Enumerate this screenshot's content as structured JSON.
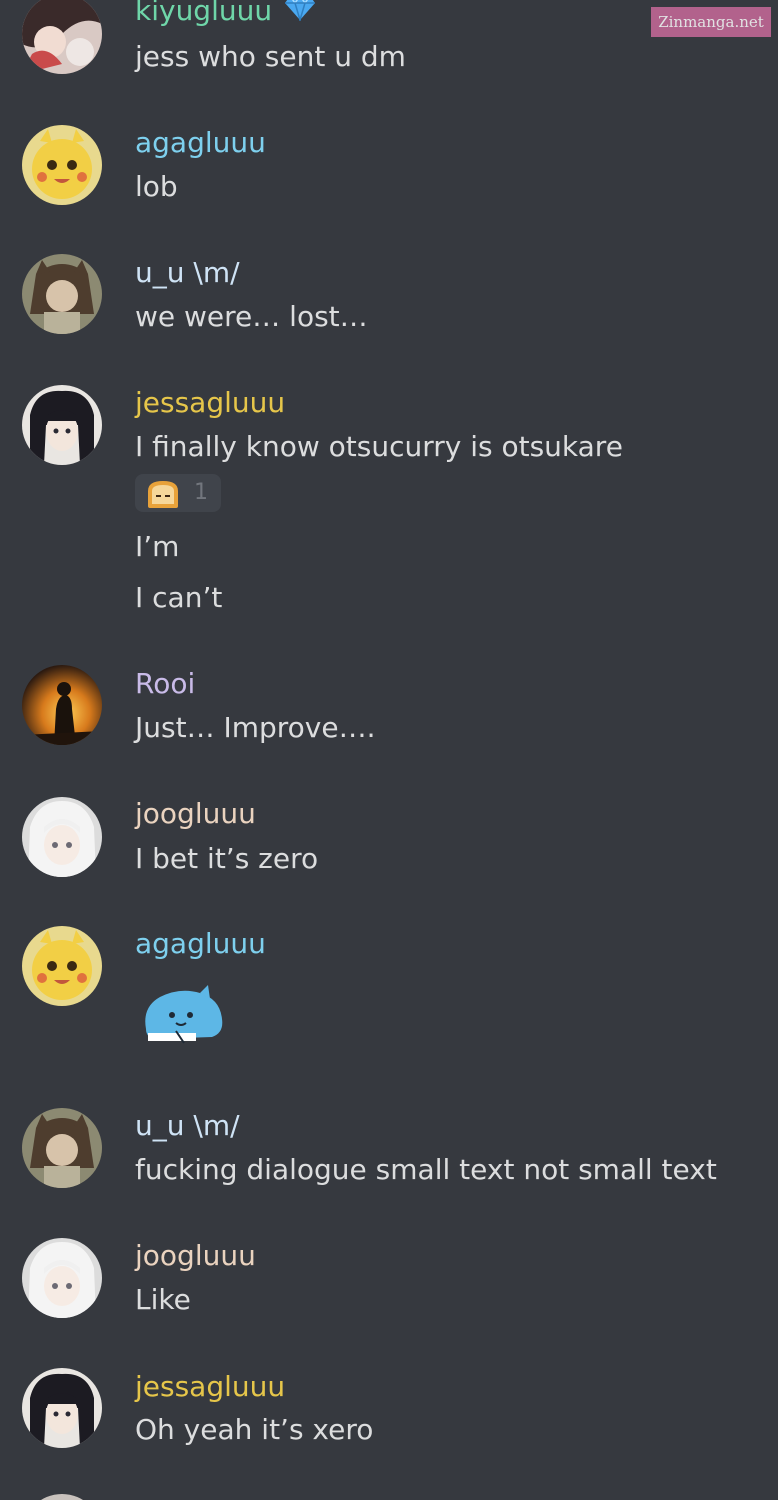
{
  "watermark": "Zinmanga.net",
  "colors": {
    "background": "#36393f",
    "message_text": "#dcddde",
    "kiyugluuu": "#6fd6a9",
    "agagluuu": "#7ed0ee",
    "u_u": "#cfe3f5",
    "jessagluuu": "#e6c64a",
    "Rooi": "#c9bbe8",
    "joogluuu": "#ead3bf",
    "reaction_bg": "#40444b"
  },
  "messages": [
    {
      "username": "kiyugluuu",
      "badge": "gem-icon",
      "avatar": "anime-girl-avatar",
      "lines": [
        "jess who sent u dm"
      ]
    },
    {
      "username": "agagluuu",
      "avatar": "yellow-pikachu-avatar",
      "lines": [
        "lob"
      ]
    },
    {
      "username": "u_u \\m/",
      "avatar": "cat-girl-avatar",
      "lines": [
        "we were… lost…"
      ]
    },
    {
      "username": "jessagluuu",
      "avatar": "dark-hair-girl-avatar",
      "lines": [
        "I finally know otsucurry is otsukare",
        "I’m",
        "I can’t"
      ],
      "reaction": {
        "emoji": "bread-emoji",
        "count": "1"
      }
    },
    {
      "username": "Rooi",
      "avatar": "sunset-silhouette-avatar",
      "lines": [
        "Just… Improve…."
      ]
    },
    {
      "username": "joogluuu",
      "avatar": "white-hair-avatar",
      "lines": [
        "I bet it’s zero"
      ]
    },
    {
      "username": "agagluuu",
      "avatar": "yellow-pikachu-avatar",
      "lines": [],
      "sticker": "blue-creature-sticker"
    },
    {
      "username": "u_u \\m/",
      "avatar": "cat-girl-avatar",
      "lines": [
        "fucking dialogue small text not small text"
      ]
    },
    {
      "username": "joogluuu",
      "avatar": "white-hair-avatar",
      "lines": [
        "Like"
      ]
    },
    {
      "username": "jessagluuu",
      "avatar": "dark-hair-girl-avatar",
      "lines": [
        "Oh yeah it’s xero"
      ]
    }
  ]
}
